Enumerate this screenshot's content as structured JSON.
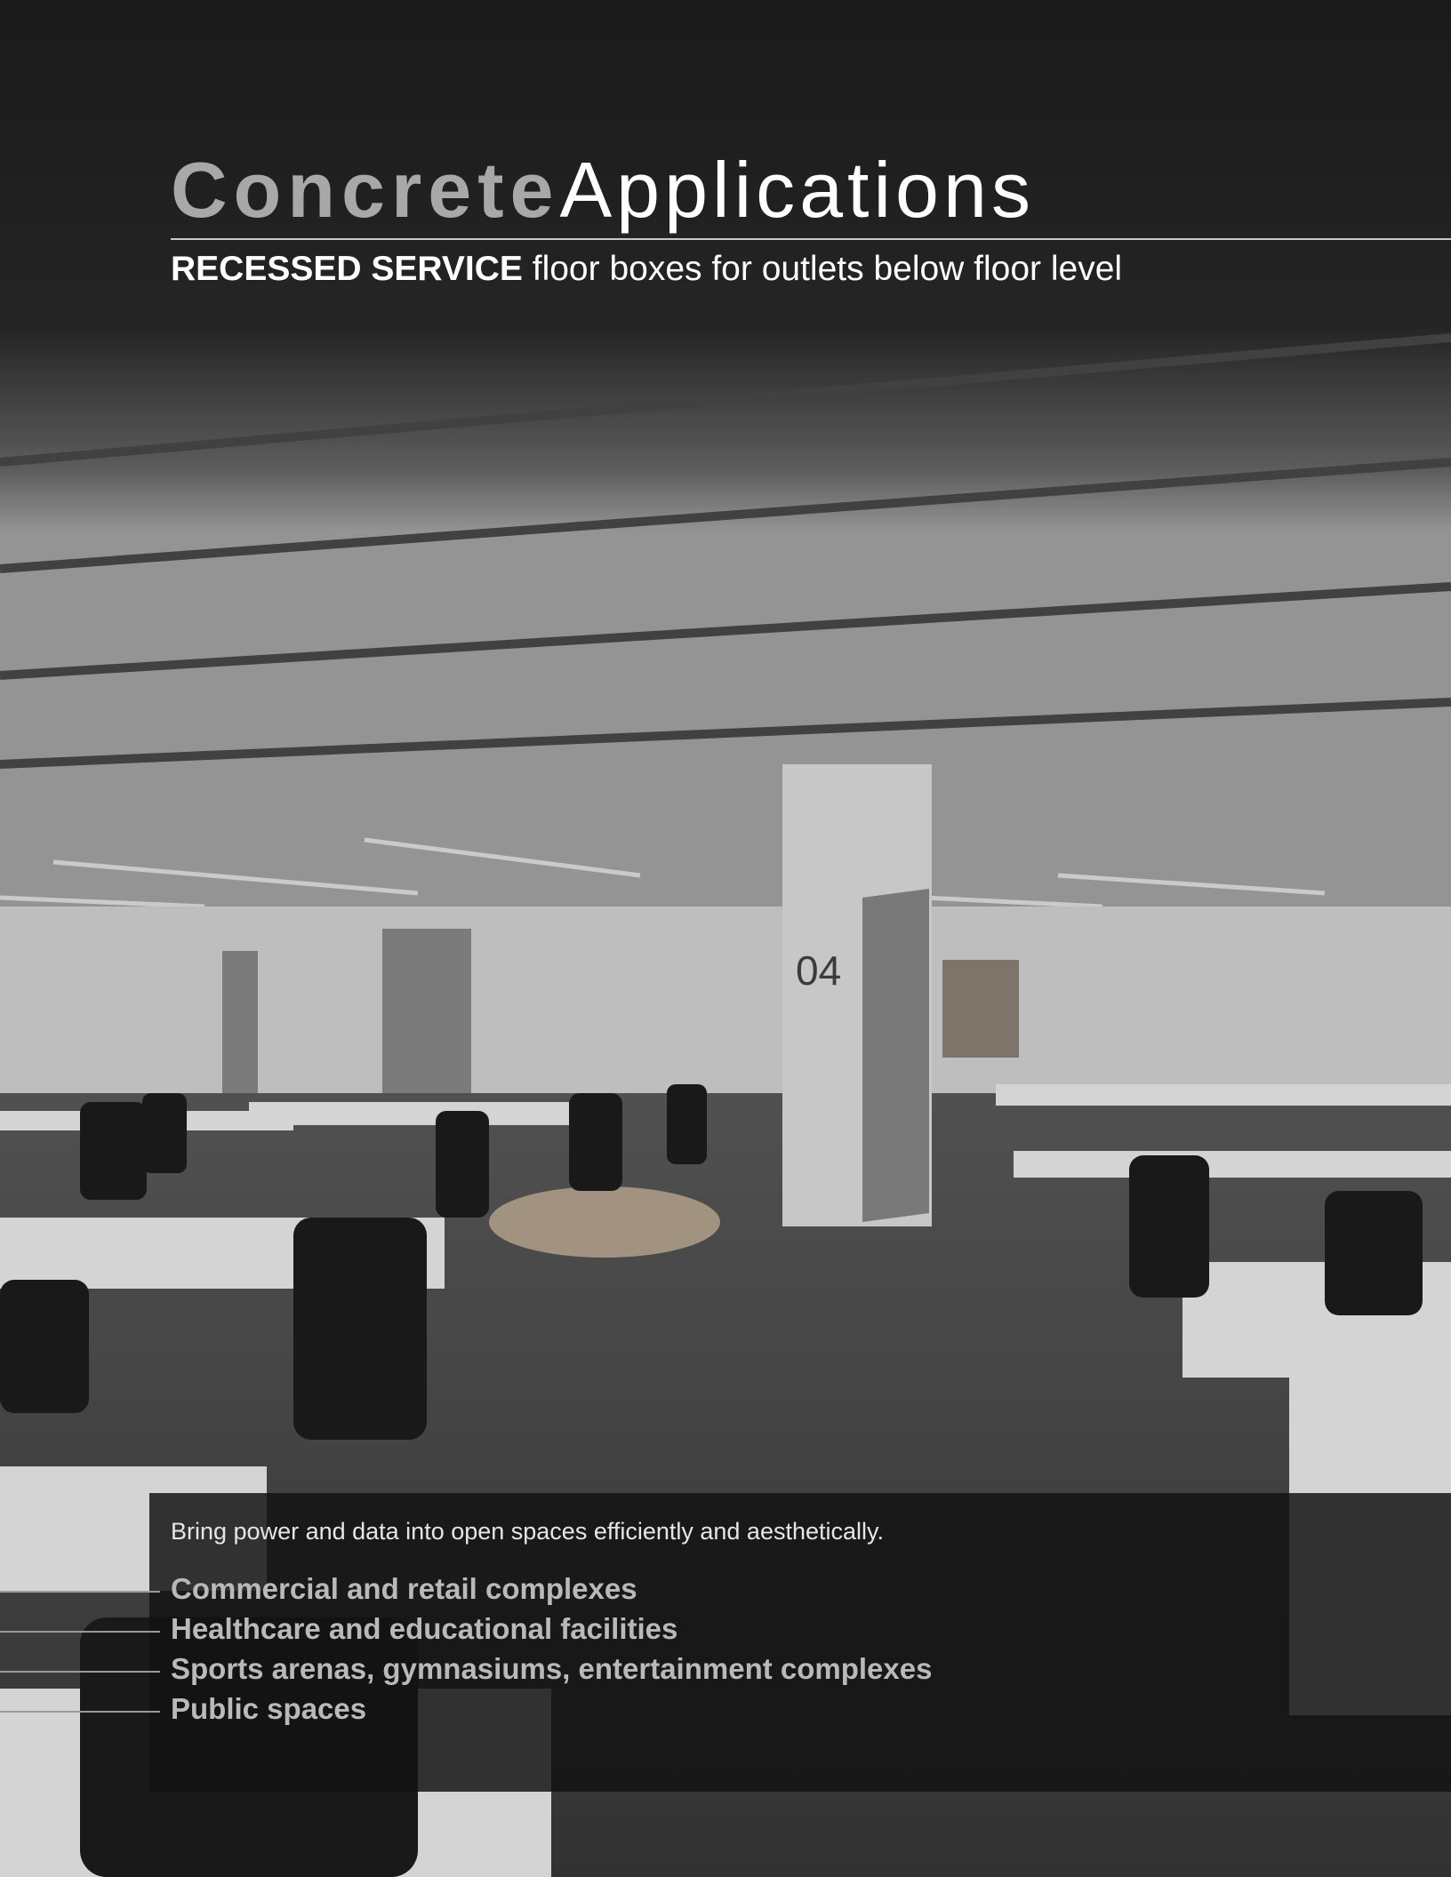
{
  "header": {
    "title_part1": "Concrete",
    "title_part2": "Applications",
    "subtitle_bold": "RECESSED SERVICE",
    "subtitle_rest": " floor boxes for outlets below floor level"
  },
  "photo": {
    "label": "office floor photograph",
    "column_number": "04"
  },
  "info": {
    "intro": "Bring power and data into open spaces efficiently and aesthetically.",
    "applications": [
      "Commercial and retail complexes",
      "Healthcare and educational facilities",
      "Sports arenas, gymnasiums, entertainment complexes",
      "Public spaces"
    ]
  },
  "colors": {
    "title_primary": "#a8a8a8",
    "title_secondary": "#ffffff",
    "rule": "#c9c9c9",
    "panel": "#121212"
  }
}
